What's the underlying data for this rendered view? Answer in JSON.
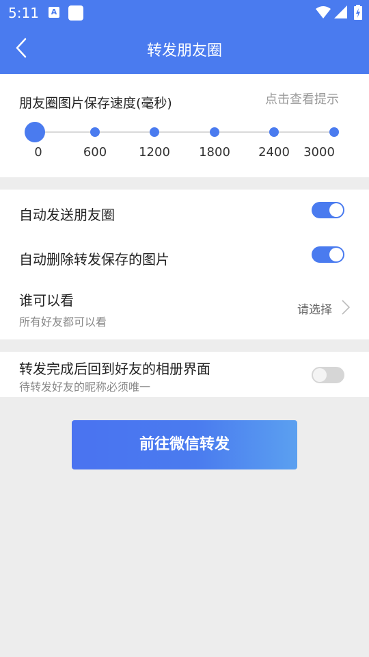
{
  "status_bar": {
    "time": "5:11",
    "a_icon_letter": "A"
  },
  "header": {
    "title": "转发朋友圈"
  },
  "speed": {
    "label": "朋友圈图片保存速度(毫秒)",
    "hint": "点击查看提示",
    "ticks": [
      "0",
      "600",
      "1200",
      "1800",
      "2400",
      "3000"
    ],
    "selected_value": 0
  },
  "settings": {
    "auto_send_label": "自动发送朋友圈",
    "auto_send_on": true,
    "auto_delete_label": "自动删除转发保存的图片",
    "auto_delete_on": true,
    "visibility_label": "谁可以看",
    "visibility_sub": "所有好友都可以看",
    "visibility_select": "请选择"
  },
  "return_row": {
    "label": "转发完成后回到好友的相册界面",
    "sub": "待转发好友的昵称必须唯一",
    "on": false
  },
  "action": {
    "button_label": "前往微信转发"
  },
  "colors": {
    "accent": "#4a7bef",
    "background": "#ededed"
  }
}
